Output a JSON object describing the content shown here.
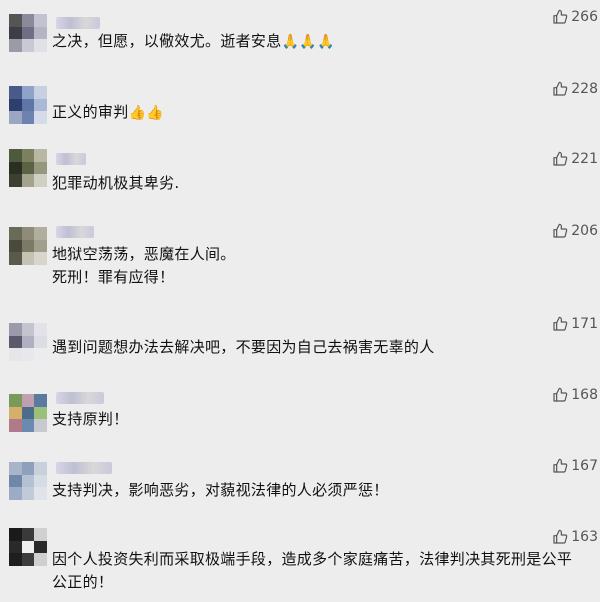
{
  "comments": [
    {
      "text": "之决，但愿，以儆效尤。逝者安息",
      "emoji": "🙏🙏🙏",
      "likes": "266",
      "colors": [
        "#555",
        "#8a8a9a",
        "#c2c2d0",
        "#3d3d46",
        "#6e6e86",
        "#b4b4c4",
        "#9a9aa8",
        "#c9c9d4",
        "#e0e0e6"
      ]
    },
    {
      "text": "正义的审判",
      "emoji": "👍👍",
      "likes": "228",
      "colors": [
        "#4a5a8a",
        "#8fa3c8",
        "#c7d0e0",
        "#2e3f6f",
        "#5f75a8",
        "#a9b8d6",
        "#9aa6c2",
        "#6e82b0",
        "#d5dbe8"
      ]
    },
    {
      "text": "犯罪动机极其卑劣.",
      "emoji": "",
      "likes": "221",
      "colors": [
        "#4e5a3c",
        "#7a8060",
        "#b8b8a2",
        "#2a2f22",
        "#5c6244",
        "#96987e",
        "#3c4030",
        "#a4a48c",
        "#cfcfc2"
      ]
    },
    {
      "text": "地狱空荡荡，恶魔在人间。\n死刑！罪有应得！",
      "emoji": "",
      "likes": "206",
      "colors": [
        "#6a6a58",
        "#8e8c78",
        "#b0ae9c",
        "#4a4a3c",
        "#7a7a66",
        "#a09e8c",
        "#5a5a4a",
        "#c4c2b4",
        "#d8d6cc"
      ]
    },
    {
      "text": "遇到问题想办法去解决吧，不要因为自己去祸害无辜的人",
      "emoji": "",
      "likes": "171",
      "colors": [
        "#9a9aaa",
        "#c4c4d0",
        "#e2e2e8",
        "#5a5a6a",
        "#b0b0c0",
        "#dcdce4",
        "#e6e6ea",
        "#e8e8ec",
        "#ececee"
      ]
    },
    {
      "text": "支持原判！",
      "emoji": "",
      "likes": "168",
      "colors": [
        "#7a9a5a",
        "#c0a0b0",
        "#5a7aa0",
        "#d4b06a",
        "#4c6c8c",
        "#9ac07a",
        "#b07a8a",
        "#6a8ab0",
        "#c8c8d0"
      ]
    },
    {
      "text": "支持判决，影响恶劣，对藐视法律的人必须严惩！",
      "emoji": "",
      "likes": "167",
      "colors": [
        "#a8b4c8",
        "#8fa0bc",
        "#c8d0dc",
        "#7088a8",
        "#b4c0d4",
        "#d6dce6",
        "#9cacc4",
        "#c0cad8",
        "#e0e4ea"
      ]
    },
    {
      "text": "因个人投资失利而采取极端手段，造成多个家庭痛苦，法律判决其死刑是公平公正的！",
      "emoji": "",
      "likes": "163",
      "colors": [
        "#1a1a1a",
        "#3a3a3a",
        "#d0d0d0",
        "#2a2a2a",
        "#f0f0f0",
        "#2a2a2a",
        "#1e1e1e",
        "#3c3c3c",
        "#cfcfcf"
      ]
    }
  ]
}
